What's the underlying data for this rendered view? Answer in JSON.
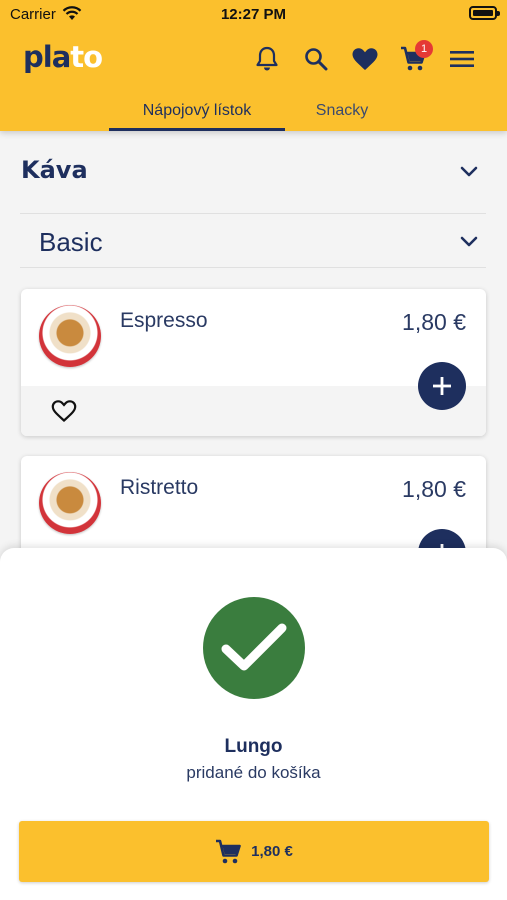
{
  "status_bar": {
    "carrier": "Carrier",
    "time": "12:27 PM"
  },
  "header": {
    "logo_part1": "pla",
    "logo_part2": "to",
    "cart_badge": "1",
    "icons": [
      "bell-icon",
      "search-icon",
      "heart-icon",
      "cart-icon",
      "menu-icon"
    ]
  },
  "tabs": [
    {
      "label": "Nápojový lístok",
      "active": true
    },
    {
      "label": "Snacky",
      "active": false
    }
  ],
  "category": {
    "title": "Káva"
  },
  "subcategory": {
    "title": "Basic"
  },
  "products": [
    {
      "name": "Espresso",
      "price": "1,80 €"
    },
    {
      "name": "Ristretto",
      "price": "1,80 €"
    }
  ],
  "confirmation": {
    "product_name": "Lungo",
    "message": "pridané do košíka",
    "button_amount": "1,80 €"
  },
  "colors": {
    "accent": "#fbc02d",
    "primary": "#1e2f5e",
    "success": "#3a7d3e",
    "badge": "#e53935"
  }
}
